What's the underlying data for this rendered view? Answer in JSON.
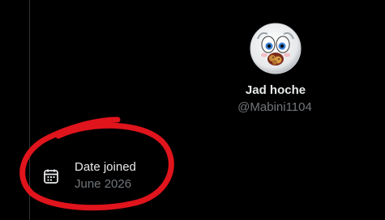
{
  "profile": {
    "display_name": "Jad hoche",
    "handle": "@Mabini1104",
    "avatar_icon": "cartoon-face-avatar"
  },
  "joined": {
    "label": "Date joined",
    "value": "June 2026",
    "icon": "calendar-icon"
  },
  "colors": {
    "background": "#000000",
    "primary_text": "#e7e9ea",
    "secondary_text": "#71767b",
    "annotation": "#e0141c"
  }
}
